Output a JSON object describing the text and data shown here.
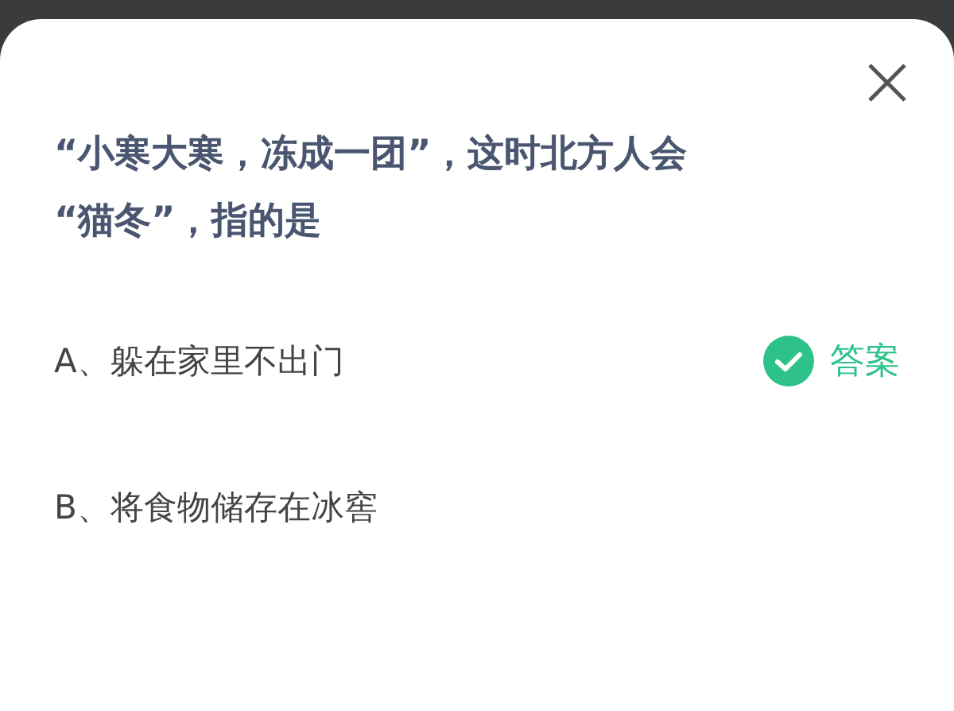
{
  "question": {
    "lines": [
      "“小寒大寒，冻成一团”，这时北方人会",
      "“猫冬”，指的是"
    ]
  },
  "answer_label": "答案",
  "options": [
    {
      "text": "A、躲在家里不出门",
      "correct": true
    },
    {
      "text": "B、将食物储存在冰窖",
      "correct": false
    }
  ]
}
